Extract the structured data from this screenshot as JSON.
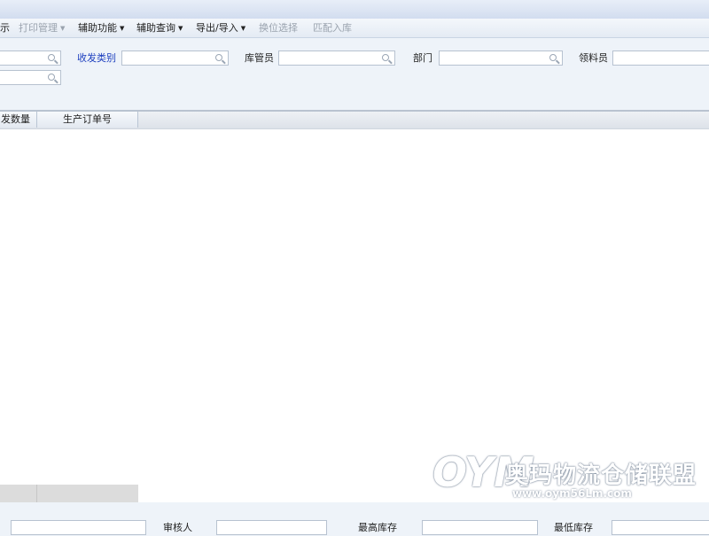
{
  "toolbar": {
    "items": [
      {
        "label": "示",
        "enabled": true,
        "dropdown": false
      },
      {
        "label": "打印管理",
        "enabled": false,
        "dropdown": true
      },
      {
        "label": "辅助功能",
        "enabled": true,
        "dropdown": true
      },
      {
        "label": "辅助查询",
        "enabled": true,
        "dropdown": true
      },
      {
        "label": "导出/导入",
        "enabled": true,
        "dropdown": true
      },
      {
        "label": "换位选择",
        "enabled": false,
        "dropdown": false
      },
      {
        "label": "匹配入库",
        "enabled": false,
        "dropdown": false
      }
    ]
  },
  "filter": {
    "category_label": "收发类别",
    "category_value": "",
    "keeper_label": "库管员",
    "keeper_value": "",
    "department_label": "部门",
    "department_value": "",
    "picker_label": "领料员",
    "picker_value": "",
    "field_a_value": "",
    "field_b_value": ""
  },
  "grid": {
    "columns": [
      "发数量",
      "生产订单号"
    ],
    "rows": []
  },
  "footer": {
    "field1_value": "",
    "reviewer_label": "审核人",
    "reviewer_value": "",
    "max_stock_label": "最高库存",
    "max_stock_value": "",
    "min_stock_label": "最低库存",
    "min_stock_value": ""
  },
  "watermark": {
    "logo": "OYM",
    "text": "奥玛物流仓储联盟",
    "url": "www.oym56Lm.com"
  },
  "colors": {
    "link_label": "#1d3fbf",
    "disabled_text": "#9aa3ae",
    "panel_bg": "#eef3f9"
  }
}
